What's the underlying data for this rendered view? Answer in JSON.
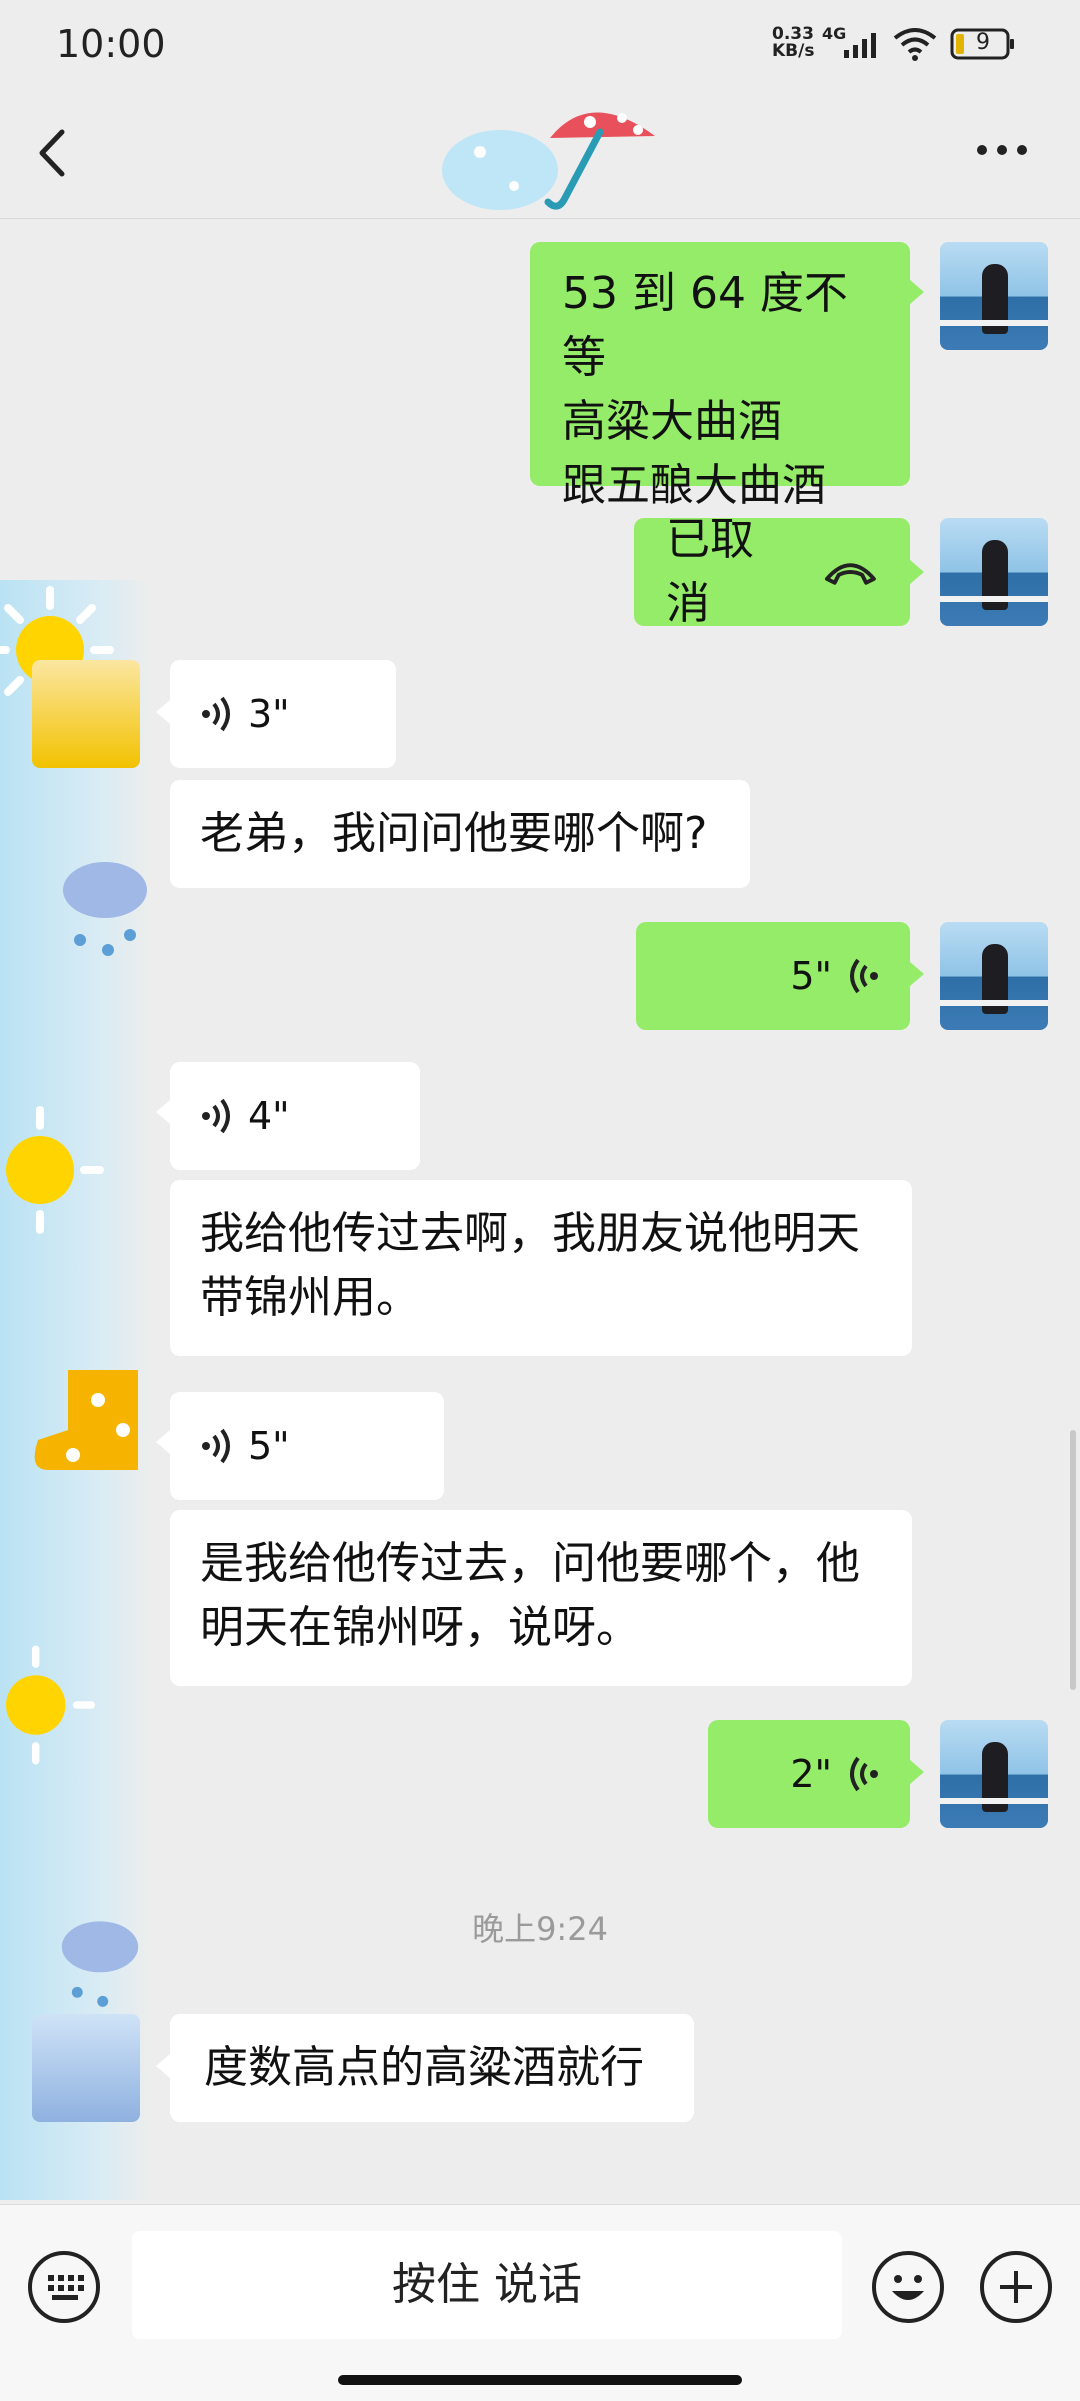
{
  "status_bar": {
    "time": "10:00",
    "net_speed_value": "0.33",
    "net_speed_unit": "KB/s",
    "net_type": "4G",
    "battery": "9"
  },
  "header": {
    "back_icon": "chevron-left-icon",
    "more_icon": "more-horizontal-icon"
  },
  "messages": [
    {
      "side": "me",
      "kind": "text",
      "lines": [
        "53 到 64 度不等",
        "高粱大曲酒",
        "跟五酿大曲酒"
      ]
    },
    {
      "side": "me",
      "kind": "call",
      "text": "已取消",
      "icon": "phone-hangup-icon"
    },
    {
      "side": "them",
      "kind": "voice",
      "duration": "3\""
    },
    {
      "side": "them",
      "kind": "text",
      "text": "老弟，我问问他要哪个啊?"
    },
    {
      "side": "me",
      "kind": "voice",
      "duration": "5\""
    },
    {
      "side": "them",
      "kind": "voice",
      "duration": "4\""
    },
    {
      "side": "them",
      "kind": "text",
      "lines": [
        "我给他传过去啊，我朋友说他明天",
        "带锦州用。"
      ]
    },
    {
      "side": "them",
      "kind": "voice",
      "duration": "5\""
    },
    {
      "side": "them",
      "kind": "text",
      "lines": [
        "是我给他传过去，问他要哪个，他",
        "明天在锦州呀，说呀。"
      ]
    },
    {
      "side": "me",
      "kind": "voice",
      "duration": "2\""
    },
    {
      "side": "them",
      "kind": "text",
      "text": "度数高点的高粱酒就行"
    }
  ],
  "time_divider": "晚上9:24",
  "input_bar": {
    "hold_to_talk": "按住 说话",
    "keyboard_icon": "keyboard-icon",
    "emoji_icon": "emoji-icon",
    "add_icon": "plus-circle-icon"
  },
  "colors": {
    "my_bubble": "#95ec69",
    "their_bubble": "#ffffff",
    "background": "#ededed"
  }
}
